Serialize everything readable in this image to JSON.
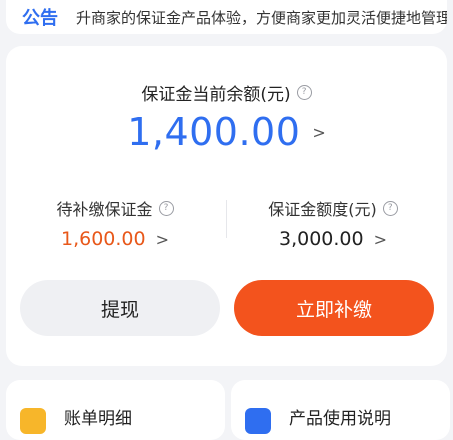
{
  "notice": {
    "tag": "公告",
    "text": "升商家的保证金产品体验，方便商家更加灵活便捷地管理"
  },
  "balance": {
    "label": "保证金当前余额(元)",
    "amount": "1,400.00"
  },
  "pending": {
    "label": "待补缴保证金",
    "amount": "1,600.00"
  },
  "quota": {
    "label": "保证金额度(元)",
    "amount": "3,000.00"
  },
  "buttons": {
    "withdraw": "提现",
    "pay_now": "立即补缴"
  },
  "shortcuts": [
    {
      "label": "账单明细",
      "icon": "bill-icon"
    },
    {
      "label": "产品使用说明",
      "icon": "guide-icon"
    }
  ],
  "colors": {
    "primary_blue": "#2f6ef0",
    "accent_orange": "#f3531d"
  }
}
